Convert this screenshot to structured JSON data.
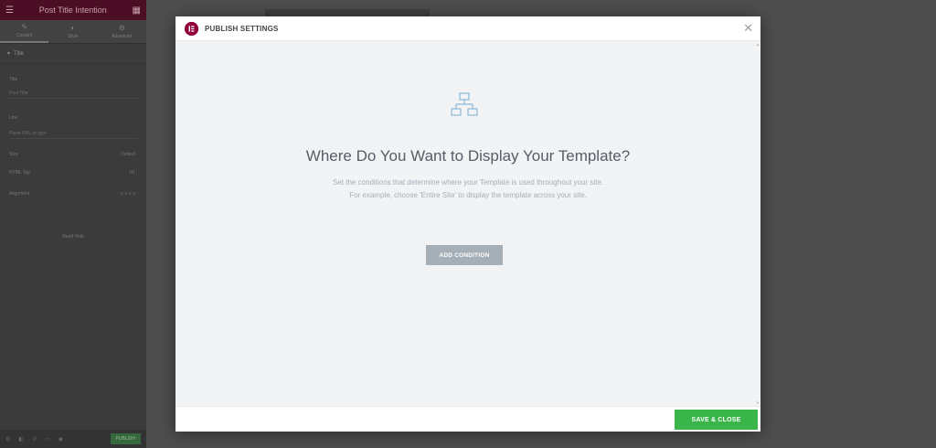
{
  "editor": {
    "panel_title": "Post Title Intention",
    "tabs": [
      {
        "label": "Content",
        "icon": "pencil-icon"
      },
      {
        "label": "Style",
        "icon": "contrast-icon"
      },
      {
        "label": "Advanced",
        "icon": "gear-icon"
      }
    ],
    "section_title": "Title",
    "controls": {
      "title_label": "Title",
      "title_value": "Post Title",
      "link_label": "Link",
      "link_placeholder": "Paste URL or type",
      "size_label": "Size",
      "size_value": "Default",
      "html_tag_label": "HTML Tag",
      "html_tag_value": "H1",
      "alignment_label": "Alignment"
    },
    "need_help": "Need Help",
    "update_label": "PUBLISH"
  },
  "modal": {
    "title": "PUBLISH SETTINGS",
    "close_icon": "close-icon",
    "headline": "Where Do You Want to Display Your Template?",
    "description_line1": "Set the conditions that determine where your Template is used throughout your site.",
    "description_line2": "For example, choose 'Entire Site' to display the template across your site.",
    "add_condition_label": "ADD CONDITION",
    "save_close_label": "SAVE & CLOSE"
  },
  "colors": {
    "brand": "#92003b",
    "save_green": "#39b54a",
    "add_button_gray": "#a4afb7",
    "headline_text": "#555d66",
    "icon_blue": "#8cb8d6"
  }
}
